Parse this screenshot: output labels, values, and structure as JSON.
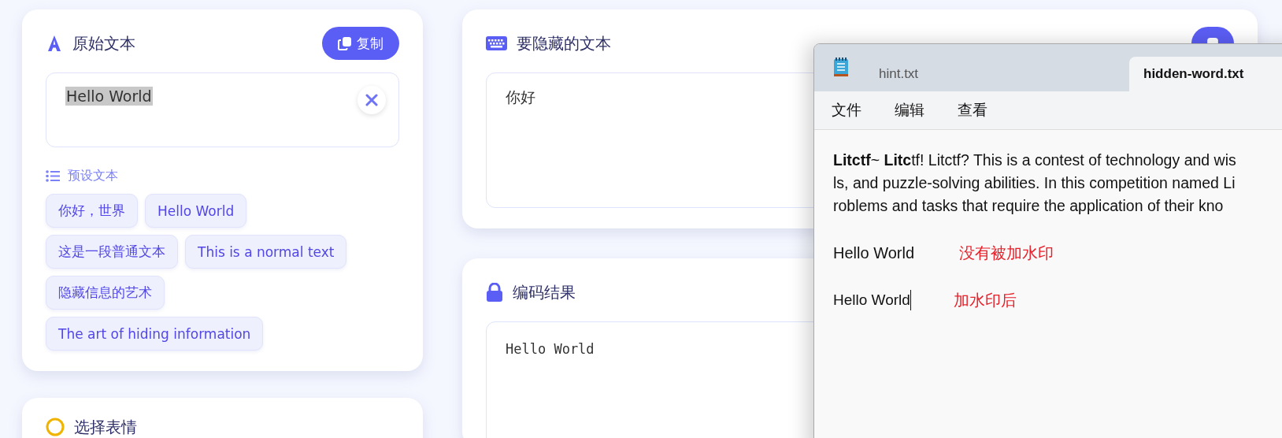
{
  "original_text": {
    "title": "原始文本",
    "copy_button": "复制",
    "value": "Hello World",
    "value_highlighted": true,
    "presets_label": "预设文本",
    "presets": [
      "你好，世界",
      "Hello World",
      "这是一段普通文本",
      "This is a normal text",
      "隐藏信息的艺术",
      "The art of hiding information"
    ]
  },
  "hidden_text": {
    "title": "要隐藏的文本",
    "value": "你好"
  },
  "encoded_result": {
    "title": "编码结果",
    "value": "Hello World"
  },
  "emoji_panel": {
    "title": "选择表情"
  },
  "notepad": {
    "tabs": [
      {
        "label": "hint.txt",
        "selected": false
      },
      {
        "label": "hidden-word.txt",
        "selected": true
      }
    ],
    "menu": [
      "文件",
      "编辑",
      "查看"
    ],
    "lines": [
      "**Litctf**~ **Litc**tf! Litctf? This is a contest of technology and wis",
      "ls, and puzzle-solving abilities. In this competition named Li",
      "roblems and tasks that require the application of their kno"
    ],
    "samples": [
      {
        "text": "Hello World",
        "note": "没有被加水印",
        "caret": false
      },
      {
        "text": "Hello World",
        "note": "加水印后",
        "caret": true
      }
    ]
  }
}
